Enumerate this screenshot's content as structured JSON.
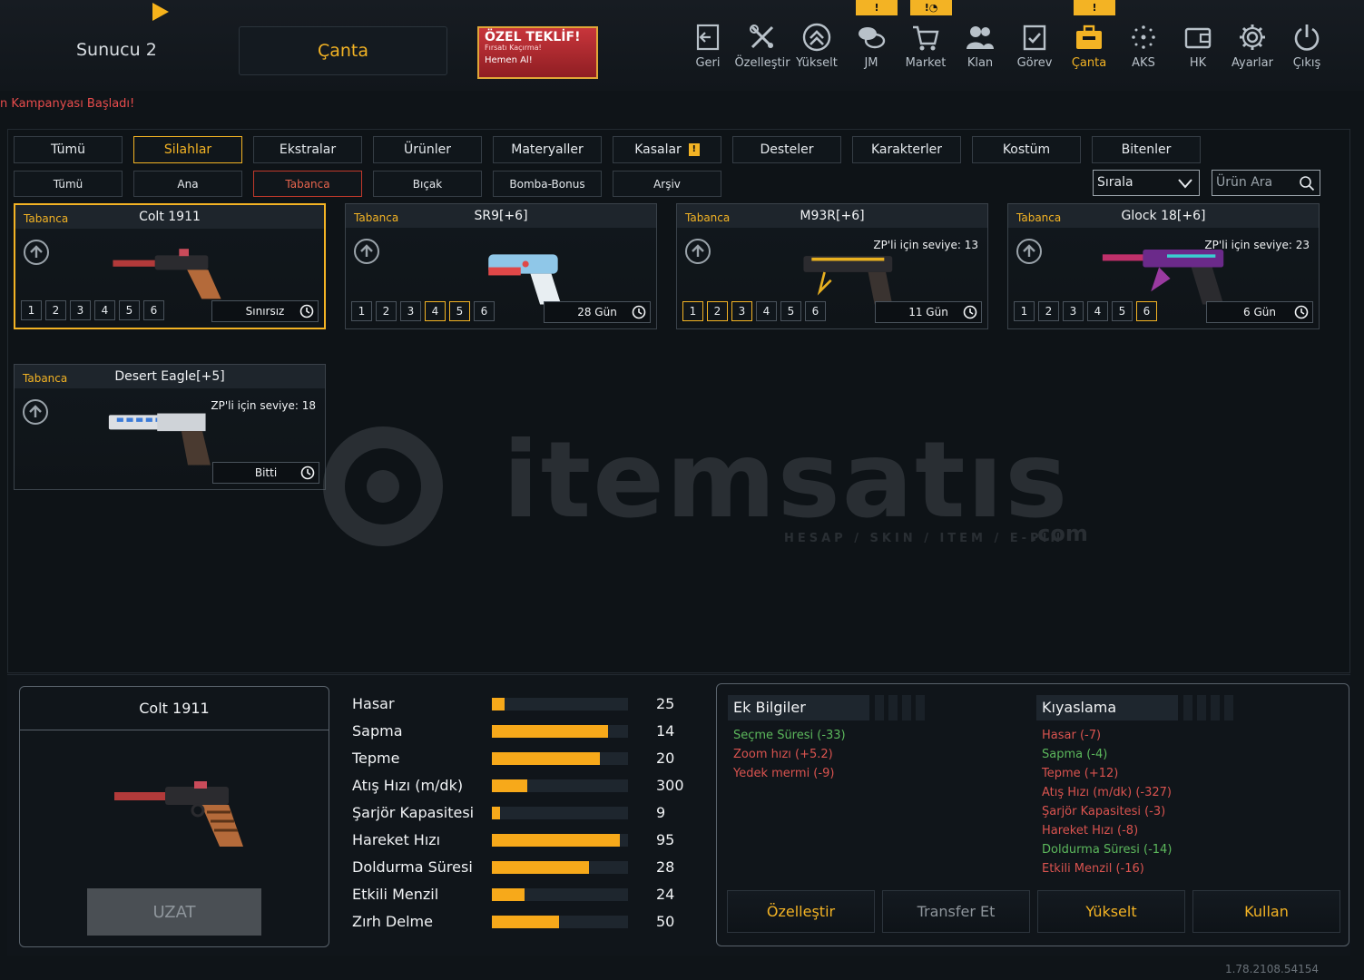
{
  "header": {
    "server": "Sunucu 2",
    "title": "Çanta",
    "offer": {
      "title": "ÖZEL TEKLİF!",
      "subtitle": "Fırsatı Kaçırma!",
      "cta": "Hemen Al!"
    }
  },
  "nav": [
    {
      "label": "Geri",
      "icon": "back-icon"
    },
    {
      "label": "Özelleştir",
      "icon": "tools-icon"
    },
    {
      "label": "Yükselt",
      "icon": "upgrade-icon"
    },
    {
      "label": "JM",
      "icon": "coins-icon",
      "badge": "!"
    },
    {
      "label": "Market",
      "icon": "cart-icon",
      "badge": "!◔"
    },
    {
      "label": "Klan",
      "icon": "clan-icon"
    },
    {
      "label": "Görev",
      "icon": "mission-icon"
    },
    {
      "label": "Çanta",
      "icon": "bag-icon",
      "badge": "!",
      "active": true
    },
    {
      "label": "AKS",
      "icon": "aks-icon"
    },
    {
      "label": "HK",
      "icon": "wallet-icon"
    },
    {
      "label": "Ayarlar",
      "icon": "gear-icon"
    },
    {
      "label": "Çıkış",
      "icon": "power-icon"
    }
  ],
  "campaign": "n Kampanyası Başladı!",
  "tabs": [
    "Tümü",
    "Silahlar",
    "Ekstralar",
    "Ürünler",
    "Materyaller",
    "Kasalar",
    "Desteler",
    "Karakterler",
    "Kostüm",
    "Bitenler"
  ],
  "active_tab": "Silahlar",
  "subtabs": [
    "Tümü",
    "Ana",
    "Tabanca",
    "Bıçak",
    "Bomba-Bonus",
    "Arşiv"
  ],
  "active_subtab": "Tabanca",
  "sort_label": "Sırala",
  "search_placeholder": "Ürün Ara",
  "items": [
    {
      "category": "Tabanca",
      "name": "Colt 1911",
      "level_text": "",
      "slots": [
        "1",
        "2",
        "3",
        "4",
        "5",
        "6"
      ],
      "active_slots": [],
      "duration": "Sınırsız",
      "selected": true
    },
    {
      "category": "Tabanca",
      "name": "SR9[+6]",
      "level_text": "",
      "slots": [
        "1",
        "2",
        "3",
        "4",
        "5",
        "6"
      ],
      "active_slots": [
        4,
        5
      ],
      "duration": "28 Gün"
    },
    {
      "category": "Tabanca",
      "name": "M93R[+6]",
      "level_text": "ZP'li için seviye: 13",
      "slots": [
        "1",
        "2",
        "3",
        "4",
        "5",
        "6"
      ],
      "active_slots": [
        1,
        2,
        3
      ],
      "duration": "11 Gün"
    },
    {
      "category": "Tabanca",
      "name": "Glock 18[+6]",
      "level_text": "ZP'li için seviye: 23",
      "slots": [
        "1",
        "2",
        "3",
        "4",
        "5",
        "6"
      ],
      "active_slots": [
        6
      ],
      "duration": "6 Gün"
    },
    {
      "category": "Tabanca",
      "name": "Desert Eagle[+5]",
      "level_text": "ZP'li için seviye: 18",
      "slots": [],
      "active_slots": [],
      "duration": "Bitti"
    }
  ],
  "watermark": {
    "text": "itemsatıs",
    "sub": "HESAP / SKIN / ITEM / E-PIN",
    "domain": ".com"
  },
  "detail": {
    "title": "Colt 1911",
    "extend_label": "UZAT",
    "stats": [
      {
        "label": "Hasar",
        "value": "25",
        "fill": 0.09
      },
      {
        "label": "Sapma",
        "value": "14",
        "fill": 0.85
      },
      {
        "label": "Tepme",
        "value": "20",
        "fill": 0.79
      },
      {
        "label": "Atış Hızı (m/dk)",
        "value": "300",
        "fill": 0.26
      },
      {
        "label": "Şarjör Kapasitesi",
        "value": "9",
        "fill": 0.06
      },
      {
        "label": "Hareket Hızı",
        "value": "95",
        "fill": 0.94
      },
      {
        "label": "Doldurma Süresi",
        "value": "28",
        "fill": 0.71
      },
      {
        "label": "Etkili Menzil",
        "value": "24",
        "fill": 0.24
      },
      {
        "label": "Zırh Delme",
        "value": "50",
        "fill": 0.49
      }
    ]
  },
  "info": {
    "extra_title": "Ek Bilgiler",
    "extra": [
      {
        "text": "Seçme Süresi (-33)",
        "tone": "green"
      },
      {
        "text": "Zoom hızı (+5.2)",
        "tone": "red"
      },
      {
        "text": "Yedek mermi (-9)",
        "tone": "red"
      }
    ],
    "compare_title": "Kıyaslama",
    "compare": [
      {
        "text": "Hasar (-7)",
        "tone": "red"
      },
      {
        "text": "Sapma (-4)",
        "tone": "green"
      },
      {
        "text": "Tepme (+12)",
        "tone": "red"
      },
      {
        "text": "Atış Hızı (m/dk) (-327)",
        "tone": "red"
      },
      {
        "text": "Şarjör Kapasitesi (-3)",
        "tone": "red"
      },
      {
        "text": "Hareket Hızı (-8)",
        "tone": "red"
      },
      {
        "text": "Doldurma Süresi (-14)",
        "tone": "green"
      },
      {
        "text": "Etkili Menzil (-16)",
        "tone": "red"
      }
    ],
    "buttons": [
      {
        "label": "Özelleştir",
        "enabled": true
      },
      {
        "label": "Transfer Et",
        "enabled": false
      },
      {
        "label": "Yükselt",
        "enabled": true
      },
      {
        "label": "Kullan",
        "enabled": true
      }
    ]
  },
  "version": "1.78.2108.54154",
  "colors": {
    "accent": "#f3b324",
    "green": "#5cb85c",
    "red": "#d9534f",
    "bg": "#0f1418"
  }
}
